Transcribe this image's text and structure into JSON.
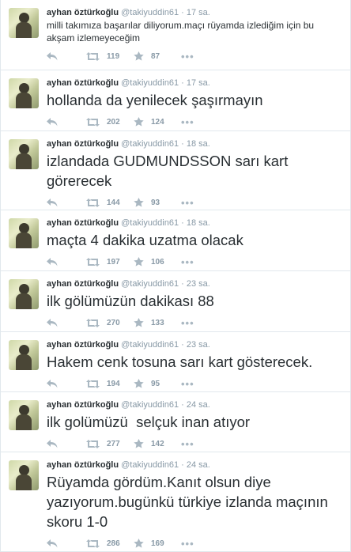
{
  "more_icon_glyph": "•••",
  "tweets": [
    {
      "name": "ayhan öztürkoğlu",
      "handle": "@takiyuddin61",
      "dot": "·",
      "time": "17 sa.",
      "size": "small",
      "text": "milli takımıza başarılar diliyorum.maçı rüyamda izlediğim için bu akşam izlemeyeceğim",
      "retweets": "119",
      "favorites": "87"
    },
    {
      "name": "ayhan öztürkoğlu",
      "handle": "@takiyuddin61",
      "dot": "·",
      "time": "17 sa.",
      "size": "large",
      "text": "hollanda da yenilecek şaşırmayın",
      "retweets": "202",
      "favorites": "124"
    },
    {
      "name": "ayhan öztürkoğlu",
      "handle": "@takiyuddin61",
      "dot": "·",
      "time": "18 sa.",
      "size": "large",
      "text": "izlandada GUDMUNDSSON sarı kart görerecek",
      "retweets": "144",
      "favorites": "93"
    },
    {
      "name": "ayhan öztürkoğlu",
      "handle": "@takiyuddin61",
      "dot": "·",
      "time": "18 sa.",
      "size": "large",
      "text": "maçta 4 dakika uzatma olacak",
      "retweets": "197",
      "favorites": "106"
    },
    {
      "name": "ayhan öztürkoğlu",
      "handle": "@takiyuddin61",
      "dot": "·",
      "time": "23 sa.",
      "size": "large",
      "text": "ilk gölümüzün dakikası 88",
      "retweets": "270",
      "favorites": "133"
    },
    {
      "name": "ayhan öztürkoğlu",
      "handle": "@takiyuddin61",
      "dot": "·",
      "time": "23 sa.",
      "size": "large",
      "text": "Hakem cenk tosuna sarı kart gösterecek.",
      "retweets": "194",
      "favorites": "95"
    },
    {
      "name": "ayhan öztürkoğlu",
      "handle": "@takiyuddin61",
      "dot": "·",
      "time": "24 sa.",
      "size": "large",
      "text": "ilk golümüzü  selçuk inan atıyor",
      "retweets": "277",
      "favorites": "142"
    },
    {
      "name": "ayhan öztürkoğlu",
      "handle": "@takiyuddin61",
      "dot": "·",
      "time": "24 sa.",
      "size": "large",
      "text": "Rüyamda gördüm.Kanıt olsun diye yazıyorum.bugünkü türkiye izlanda maçının skoru 1-0",
      "retweets": "286",
      "favorites": "169"
    }
  ]
}
